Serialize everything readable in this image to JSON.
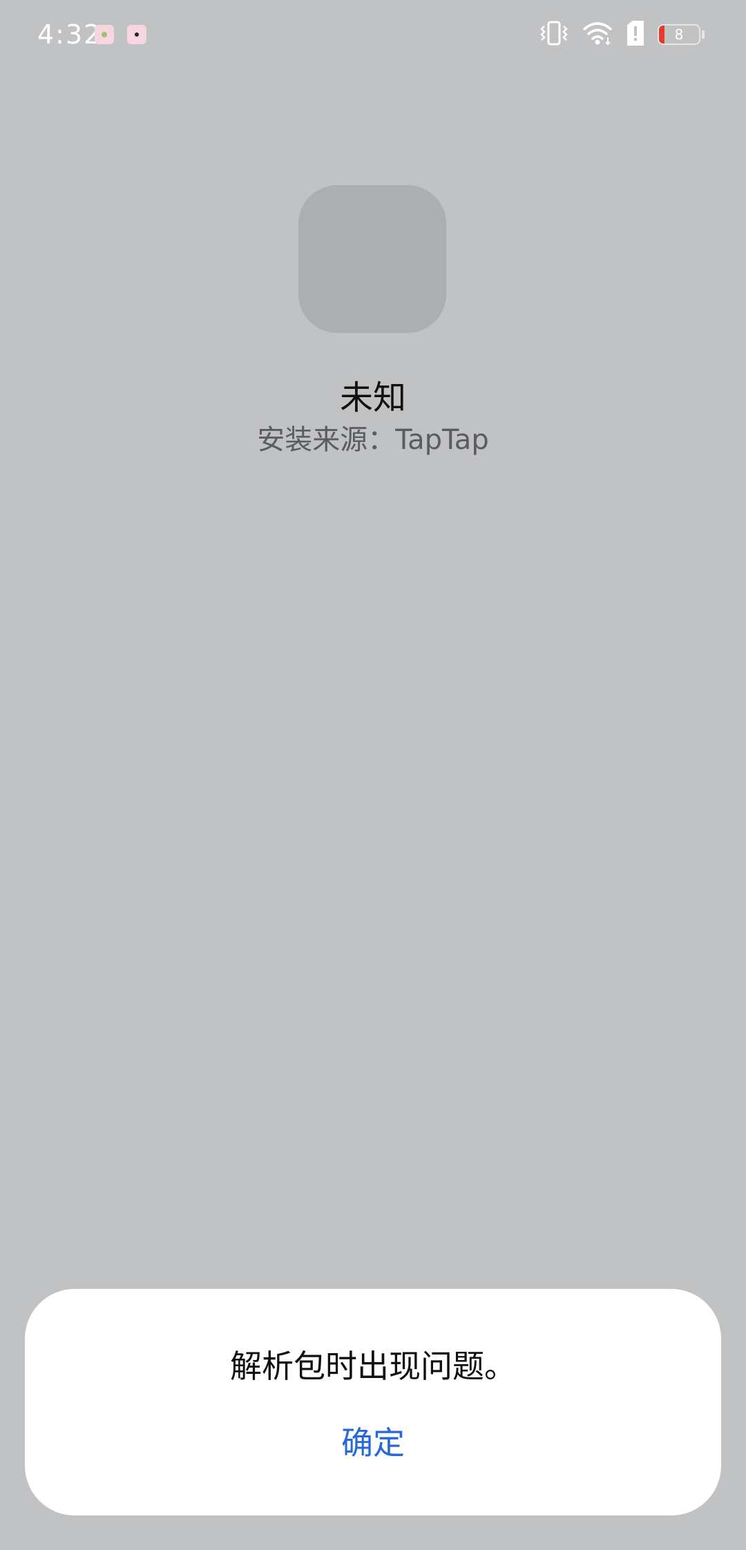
{
  "status_bar": {
    "time": "4:32",
    "battery_level": "8",
    "icons": [
      "notification-app-icon",
      "notification-app-icon",
      "vibrate-icon",
      "wifi-icon",
      "sim-alert-icon",
      "battery-icon"
    ],
    "battery_low_color": "#e53a2e"
  },
  "app": {
    "name": "未知",
    "install_source": "安装来源：TapTap"
  },
  "dialog": {
    "message": "解析包时出现问题。",
    "confirm_label": "确定",
    "confirm_color": "#2468d9"
  }
}
